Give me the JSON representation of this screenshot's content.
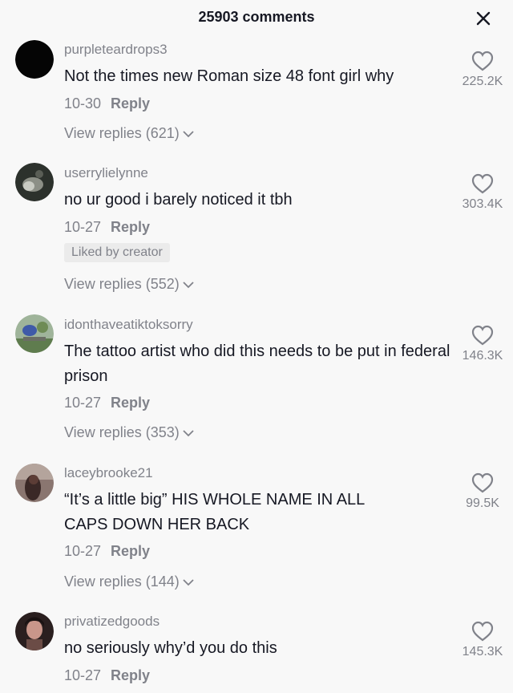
{
  "header": {
    "title": "25903 comments"
  },
  "comments": [
    {
      "username": "purpleteardrops3",
      "text": "Not the times new Roman size 48 font girl why",
      "date": "10-30",
      "reply_label": "Reply",
      "view_replies": "View replies (621)",
      "likes": "225.2K"
    },
    {
      "username": "userrylielynne",
      "text": "no ur good i barely noticed it tbh",
      "date": "10-27",
      "reply_label": "Reply",
      "badge": "Liked by creator",
      "view_replies": "View replies (552)",
      "likes": "303.4K"
    },
    {
      "username": "idonthaveatiktoksorry",
      "text": "The tattoo artist who did this needs to be put in federal prison",
      "date": "10-27",
      "reply_label": "Reply",
      "view_replies": "View replies (353)",
      "likes": "146.3K"
    },
    {
      "username": "laceybrooke21",
      "text": "“It’s a little big” HIS WHOLE NAME IN ALL CAPS DOWN HER BACK",
      "date": "10-27",
      "reply_label": "Reply",
      "view_replies": "View replies (144)",
      "likes": "99.5K"
    },
    {
      "username": "privatizedgoods",
      "text": "no seriously why’d you do this",
      "date": "10-27",
      "reply_label": "Reply",
      "likes": "145.3K"
    }
  ],
  "colors": {
    "text_primary": "#161823",
    "text_secondary": "#80828a",
    "background": "#f8f8f8"
  }
}
